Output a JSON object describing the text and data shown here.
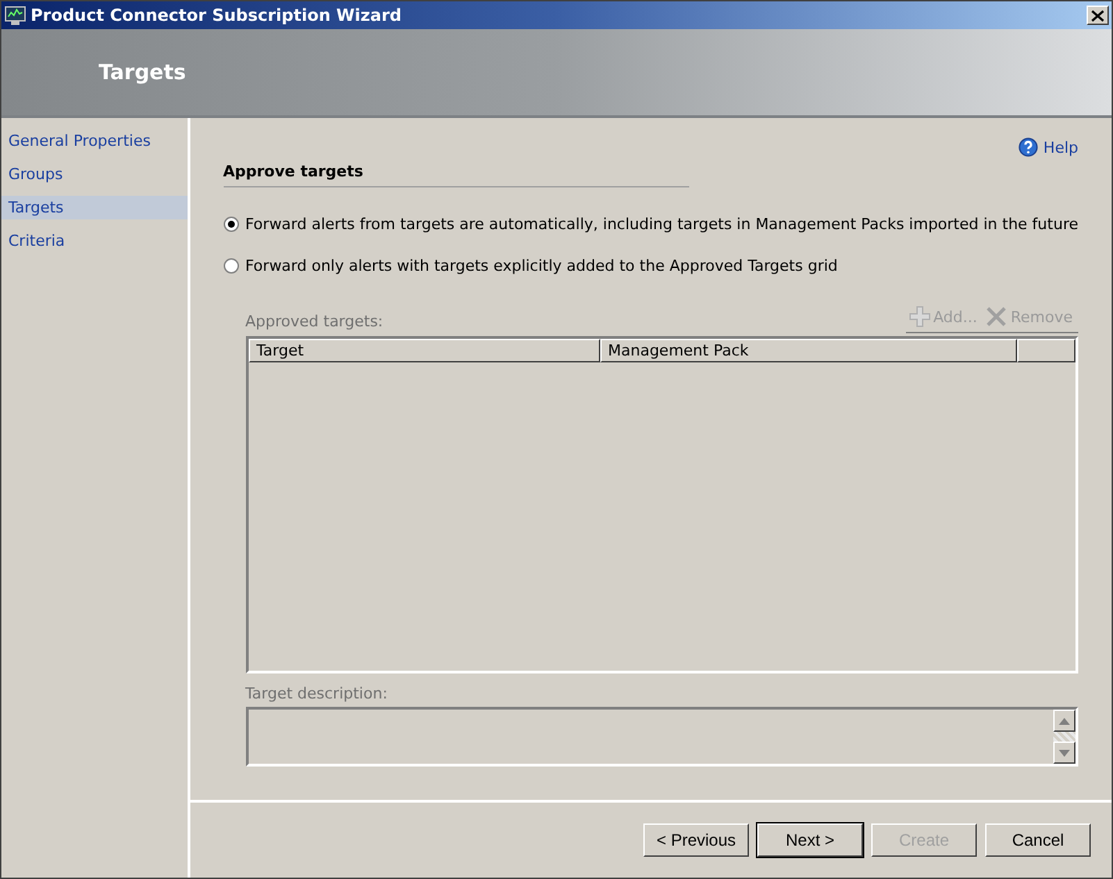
{
  "window": {
    "title": "Product Connector Subscription Wizard"
  },
  "header": {
    "title": "Targets"
  },
  "sidebar": {
    "items": [
      {
        "label": "General Properties",
        "selected": false
      },
      {
        "label": "Groups",
        "selected": false
      },
      {
        "label": "Targets",
        "selected": true
      },
      {
        "label": "Criteria",
        "selected": false
      }
    ]
  },
  "help": {
    "label": "Help"
  },
  "section": {
    "title": "Approve targets"
  },
  "options": [
    {
      "label": "Forward alerts from targets are automatically, including targets in Management Packs imported in the future",
      "selected": true
    },
    {
      "label": "Forward only alerts with targets explicitly added to the Approved Targets grid",
      "selected": false
    }
  ],
  "grid": {
    "label": "Approved targets:",
    "add": {
      "label": "Add...",
      "disabled": true
    },
    "remove": {
      "label": "Remove",
      "disabled": true
    },
    "columns": [
      "Target",
      "Management Pack"
    ]
  },
  "description": {
    "label": "Target description:"
  },
  "buttons": [
    {
      "label": "< Previous",
      "disabled": false,
      "default": false
    },
    {
      "label": "Next >",
      "disabled": false,
      "default": true
    },
    {
      "label": "Create",
      "disabled": true,
      "default": false
    },
    {
      "label": "Cancel",
      "disabled": false,
      "default": false
    }
  ]
}
